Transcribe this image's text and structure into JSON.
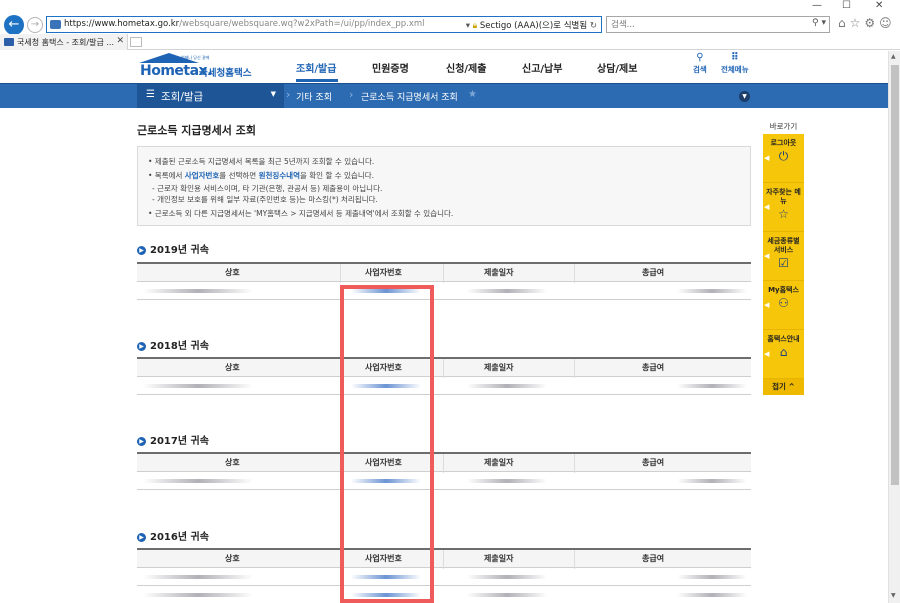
{
  "browser": {
    "window_controls": [
      "—",
      "☐",
      "✕"
    ],
    "back_glyph": "←",
    "fwd_glyph": "→",
    "url": "https://www.hometax.go.kr",
    "url_path": "/websquare/websquare.wq?w2xPath=/ui/pp/index_pp.xml",
    "cert_text": "Sectigo (AAA)(으)로 식별됨",
    "search_placeholder": "검색...",
    "tab_title": "국세청 홈택스 - 조회/발급 ...",
    "toolbar_icons": "⌂☆⚙☺"
  },
  "site": {
    "logo_small": "언제나 당신 곁에",
    "logo_main": "Hometax.",
    "logo_sub": "국세청홈택스",
    "nav": [
      "조회/발급",
      "민원증명",
      "신청/제출",
      "신고/납부",
      "상담/제보"
    ],
    "active_nav": "조회/발급",
    "tools": [
      {
        "label": "검색",
        "icon": "search-icon",
        "glyph": "⚲"
      },
      {
        "label": "전체메뉴",
        "icon": "grid-menu-icon",
        "glyph": "⠿"
      }
    ]
  },
  "location": {
    "menu_label": "조회/발급",
    "breadcrumb": [
      "기타 조회",
      "근로소득 지급명세서 조회"
    ]
  },
  "page": {
    "title": "근로소득 지급명세서 조회",
    "notices": [
      "• 제출된 근로소득 지급명세서 목록을 최근 5년까지 조회할 수 있습니다.",
      "• 목록에서 ",
      "사업자번호",
      "를 선택하면 ",
      "원천징수내역",
      "을 확인 할 수 있습니다.",
      "- 근로자 확인용 서비스이며, 타 기관(은행, 관공서 등) 제출용이 아닙니다.",
      "- 개인정보 보호를 위해 일부 자료(주민번호 등)는 마스킹(*) 처리됩니다.",
      "• 근로소득 외 다른 지급명세서는 'MY홈택스 > 지급명세서 등 제출내역'에서 조회할 수 있습니다."
    ],
    "columns": [
      "상호",
      "사업자번호",
      "제출일자",
      "총급여"
    ],
    "years": [
      {
        "title": "2019년 귀속"
      },
      {
        "title": "2018년 귀속"
      },
      {
        "title": "2017년 귀속"
      },
      {
        "title": "2016년 귀속"
      }
    ]
  },
  "quick_menu": {
    "title": "바로가기",
    "items": [
      {
        "label": "로그아웃",
        "icon": "logout-icon",
        "glyph": "⏻"
      },
      {
        "label": "자주찾는 메뉴",
        "icon": "star-icon",
        "glyph": "☆"
      },
      {
        "label": "세금종류별 서비스",
        "icon": "checkbox-icon",
        "glyph": "☑"
      },
      {
        "label": "My홈택스",
        "icon": "user-icon",
        "glyph": "⚇"
      },
      {
        "label": "홈택스안내",
        "icon": "home-guide-icon",
        "glyph": "⌂"
      }
    ],
    "close_label": "접기 ^"
  },
  "colors": {
    "brand": "#1e63b4",
    "location_bar": "#2c6bb1",
    "quick_menu": "#f6c60b",
    "highlight": "#ef5b5b"
  }
}
